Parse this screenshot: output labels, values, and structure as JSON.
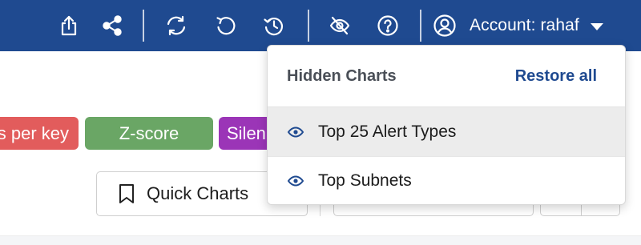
{
  "topbar": {
    "icons": [
      "share-export-icon",
      "share-nodes-icon",
      "refresh-icon",
      "reload-icon",
      "history-icon",
      "eye-hidden-icon",
      "help-icon"
    ],
    "account_label": "Account: rahaf",
    "colors": {
      "background": "#1f4a90",
      "foreground": "#ffffff"
    }
  },
  "filters": {
    "pills": [
      {
        "label": "s per key",
        "color": "#e25c5c"
      },
      {
        "label": "Z-score",
        "color": "#6aa665"
      },
      {
        "label": "Silen",
        "color": "#9b35b7"
      }
    ]
  },
  "toolbar": {
    "quick_charts_label": "Quick Charts"
  },
  "hidden_charts_menu": {
    "title": "Hidden Charts",
    "restore_all_label": "Restore all",
    "items": [
      {
        "label": "Top 25 Alert Types",
        "icon": "eye-icon",
        "highlighted": true
      },
      {
        "label": "Top Subnets",
        "icon": "eye-icon",
        "highlighted": false
      }
    ]
  }
}
